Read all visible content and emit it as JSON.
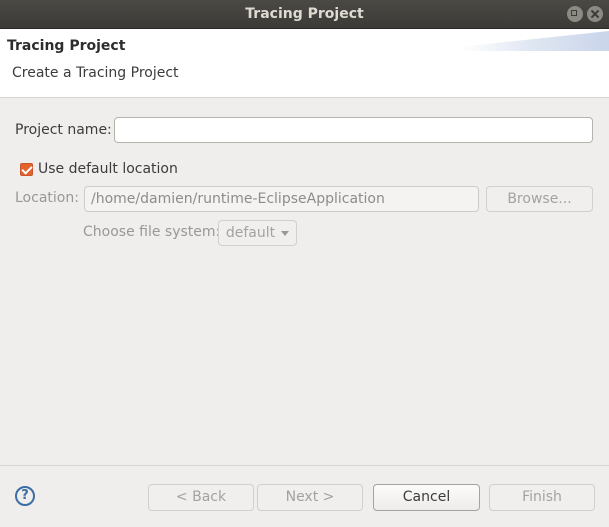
{
  "window": {
    "title": "Tracing Project"
  },
  "header": {
    "title": "Tracing Project",
    "description": "Create a Tracing Project"
  },
  "form": {
    "project_name_label": "Project name:",
    "project_name_value": "",
    "use_default_label": "Use default location",
    "use_default_checked": true,
    "location_label": "Location:",
    "location_value": "/home/damien/runtime-EclipseApplication",
    "browse_label": "Browse...",
    "file_system_label": "Choose file system:",
    "file_system_value": "default"
  },
  "footer": {
    "help_glyph": "?",
    "back_label": "< Back",
    "next_label": "Next >",
    "cancel_label": "Cancel",
    "finish_label": "Finish"
  },
  "colors": {
    "titlebar": "#3c3b37",
    "accent_checkbox": "#e2632d",
    "help_icon": "#3b6ea5"
  }
}
